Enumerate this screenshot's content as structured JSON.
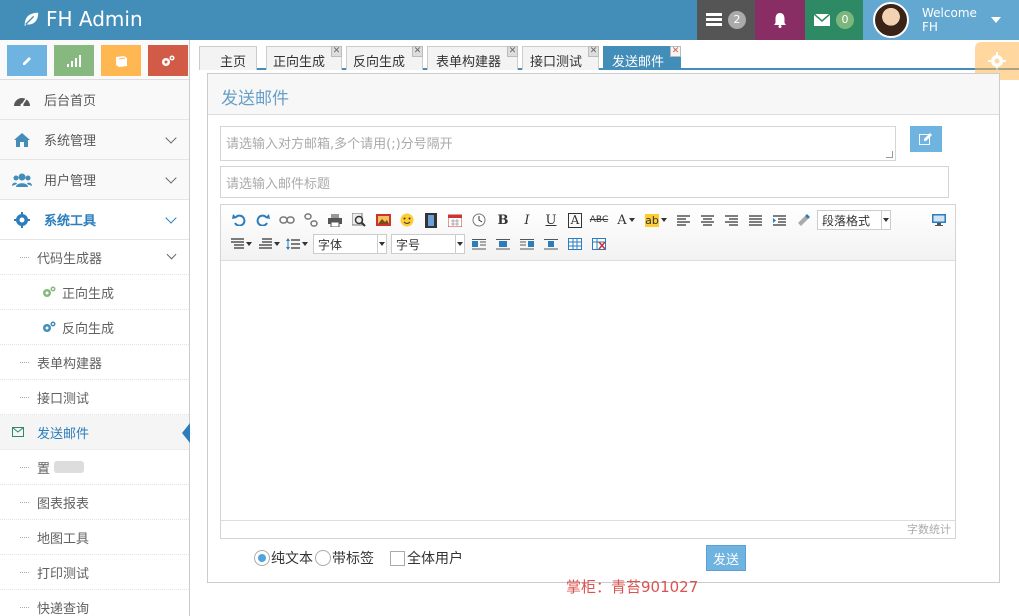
{
  "brand": {
    "title": "FH Admin"
  },
  "navbar": {
    "tasks_count": "2",
    "mail_count": "0",
    "welcome": "Welcome",
    "username": "FH"
  },
  "sidebar": {
    "items": [
      {
        "label": "后台首页",
        "icon": "dashboard-icon"
      },
      {
        "label": "系统管理",
        "icon": "home-icon"
      },
      {
        "label": "用户管理",
        "icon": "users-icon"
      },
      {
        "label": "系统工具",
        "icon": "cogs-icon"
      }
    ],
    "sub": {
      "codegen": "代码生成器",
      "forward": "正向生成",
      "reverse": "反向生成",
      "form_builder": "表单构建器",
      "api_test": "接口测试",
      "send_mail": "发送邮件",
      "partial": "置",
      "chart_report": "图表报表",
      "map_tool": "地图工具",
      "print_test": "打印测试",
      "express_query": "快递查询"
    }
  },
  "tabs": [
    "主页",
    "正向生成",
    "反向生成",
    "表单构建器",
    "接口测试",
    "发送邮件"
  ],
  "panel": {
    "title": "发送邮件"
  },
  "form": {
    "to_placeholder": "请选输入对方邮箱,多个请用(;)分号隔开",
    "subject_placeholder": "请选输入邮件标题"
  },
  "editor": {
    "paragraph_format": "段落格式",
    "font_family": "字体",
    "font_size": "字号",
    "word_count": "字数统计"
  },
  "options": {
    "plain_text": "纯文本",
    "with_tags": "带标签",
    "all_users": "全体用户",
    "selected": "plain_text"
  },
  "send_label": "发送",
  "watermark": "掌柜：青苔901027",
  "colors": {
    "navbar": "#438eb9",
    "accent": "#6fb3e0",
    "title": "#669fc7"
  }
}
